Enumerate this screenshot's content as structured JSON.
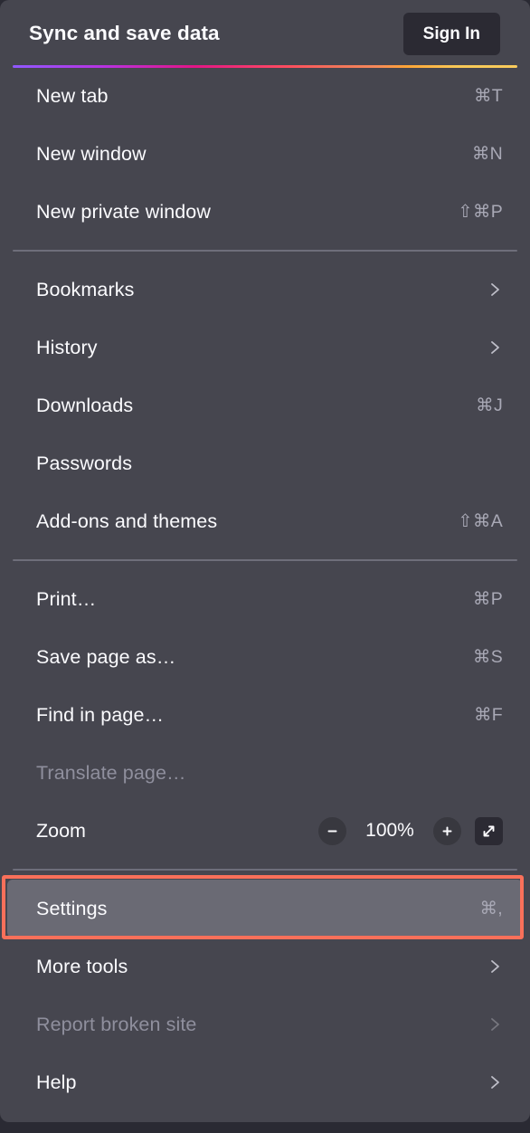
{
  "panel": {
    "background": "#46464f",
    "header": {
      "title": "Sync and save data",
      "signin_label": "Sign In"
    },
    "gradient_colors": [
      "#9059ff",
      "#b833e1",
      "#e31587",
      "#ff4f5e",
      "#f2705a",
      "#ffa436",
      "#f9cb5c"
    ],
    "groups": [
      {
        "items": [
          {
            "label": "New tab",
            "shortcut": "⌘T",
            "submenu": false,
            "disabled": false
          },
          {
            "label": "New window",
            "shortcut": "⌘N",
            "submenu": false,
            "disabled": false
          },
          {
            "label": "New private window",
            "shortcut": "⇧⌘P",
            "submenu": false,
            "disabled": false
          }
        ]
      },
      {
        "items": [
          {
            "label": "Bookmarks",
            "shortcut": "",
            "submenu": true,
            "disabled": false
          },
          {
            "label": "History",
            "shortcut": "",
            "submenu": true,
            "disabled": false
          },
          {
            "label": "Downloads",
            "shortcut": "⌘J",
            "submenu": false,
            "disabled": false
          },
          {
            "label": "Passwords",
            "shortcut": "",
            "submenu": false,
            "disabled": false
          },
          {
            "label": "Add-ons and themes",
            "shortcut": "⇧⌘A",
            "submenu": false,
            "disabled": false
          }
        ]
      },
      {
        "items": [
          {
            "label": "Print…",
            "shortcut": "⌘P",
            "submenu": false,
            "disabled": false
          },
          {
            "label": "Save page as…",
            "shortcut": "⌘S",
            "submenu": false,
            "disabled": false
          },
          {
            "label": "Find in page…",
            "shortcut": "⌘F",
            "submenu": false,
            "disabled": false
          },
          {
            "label": "Translate page…",
            "shortcut": "",
            "submenu": false,
            "disabled": true
          }
        ]
      }
    ],
    "zoom": {
      "label": "Zoom",
      "value": "100%",
      "decrease_icon": "minus-icon",
      "increase_icon": "plus-icon",
      "fullscreen_icon": "expand-diagonal-icon"
    },
    "bottom_group": [
      {
        "label": "Settings",
        "shortcut": "⌘,",
        "submenu": false,
        "disabled": false,
        "highlighted": true
      },
      {
        "label": "More tools",
        "shortcut": "",
        "submenu": true,
        "disabled": false,
        "highlighted": false
      },
      {
        "label": "Report broken site",
        "shortcut": "",
        "submenu": true,
        "disabled": true,
        "highlighted": false
      },
      {
        "label": "Help",
        "shortcut": "",
        "submenu": true,
        "disabled": false,
        "highlighted": false
      }
    ]
  },
  "annotation": {
    "target": "Settings",
    "color": "#f9705a"
  }
}
